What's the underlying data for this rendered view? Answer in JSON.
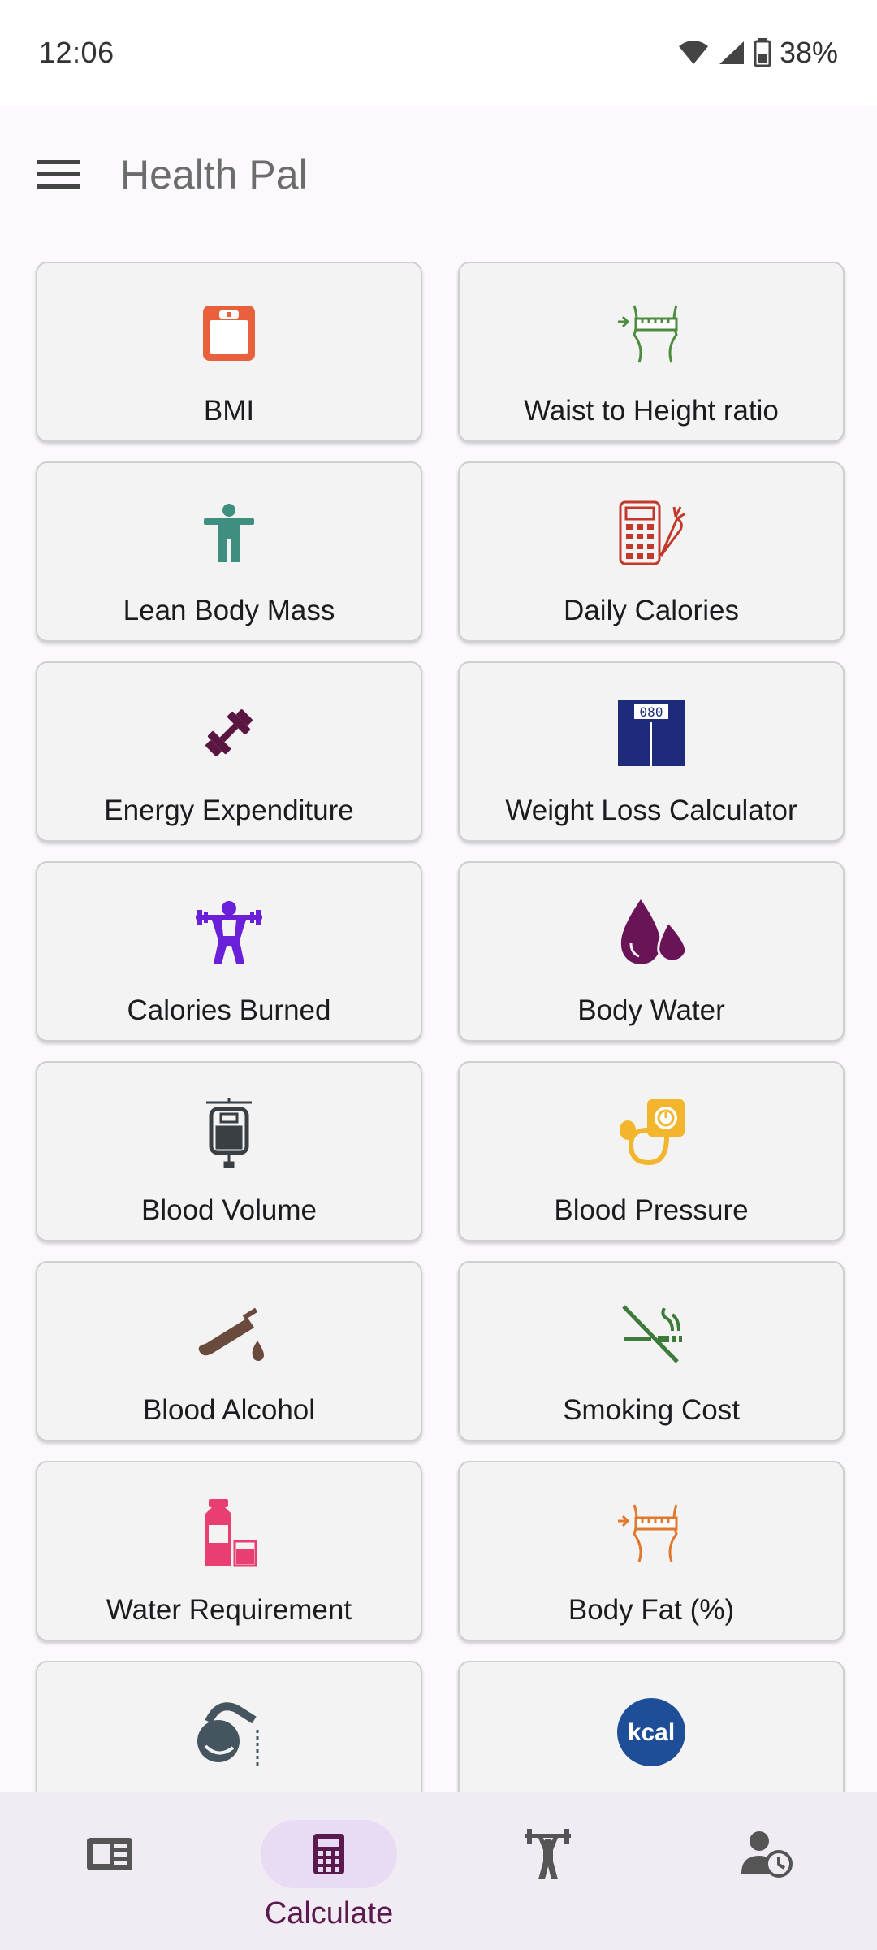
{
  "status": {
    "time": "12:06",
    "battery": "38%"
  },
  "app": {
    "title": "Health Pal"
  },
  "cards": [
    {
      "label": "BMI",
      "icon": "scale-icon"
    },
    {
      "label": "Waist to Height ratio",
      "icon": "waist-measure-icon"
    },
    {
      "label": "Lean Body Mass",
      "icon": "person-icon"
    },
    {
      "label": "Daily Calories",
      "icon": "calculator-carrot-icon"
    },
    {
      "label": "Energy Expenditure",
      "icon": "dumbbell-icon"
    },
    {
      "label": "Weight Loss Calculator",
      "icon": "digital-scale-icon"
    },
    {
      "label": "Calories Burned",
      "icon": "weightlifter-icon"
    },
    {
      "label": "Body Water",
      "icon": "water-drops-icon"
    },
    {
      "label": "Blood Volume",
      "icon": "blood-bag-icon"
    },
    {
      "label": "Blood Pressure",
      "icon": "blood-pressure-icon"
    },
    {
      "label": "Blood Alcohol",
      "icon": "test-tube-icon"
    },
    {
      "label": "Smoking Cost",
      "icon": "no-smoking-icon"
    },
    {
      "label": "Water Requirement",
      "icon": "water-bottle-icon"
    },
    {
      "label": "Body Fat (%)",
      "icon": "body-fat-measure-icon"
    },
    {
      "label": "",
      "icon": "kettlebell-pour-icon"
    },
    {
      "label": "",
      "icon": "kcal-icon",
      "icon_text": "kcal"
    }
  ],
  "nav": {
    "items": [
      {
        "name": "news",
        "icon": "news-icon",
        "label": ""
      },
      {
        "name": "calculate",
        "icon": "calculator-icon",
        "label": "Calculate",
        "active": true
      },
      {
        "name": "workout",
        "icon": "weightlifter-nav-icon",
        "label": ""
      },
      {
        "name": "history",
        "icon": "user-clock-icon",
        "label": ""
      }
    ]
  },
  "colors": {
    "accent": "#5a1a4e",
    "bmi": "#e8603c",
    "waist": "#4d8c3e",
    "lean": "#3f8f80",
    "daily": "#c0392b",
    "energy": "#5a1540",
    "weightloss": "#1e2a7a",
    "burned": "#6a1fd8",
    "water": "#6a1458",
    "bloodvol": "#3a3f44",
    "bp": "#f3b52b",
    "alcohol": "#6b4a3e",
    "smoking": "#3e7a3a",
    "waterreq": "#e83e72",
    "bodyfat": "#e2782e",
    "kettle": "#455560",
    "kcal": "#1f4e99"
  }
}
